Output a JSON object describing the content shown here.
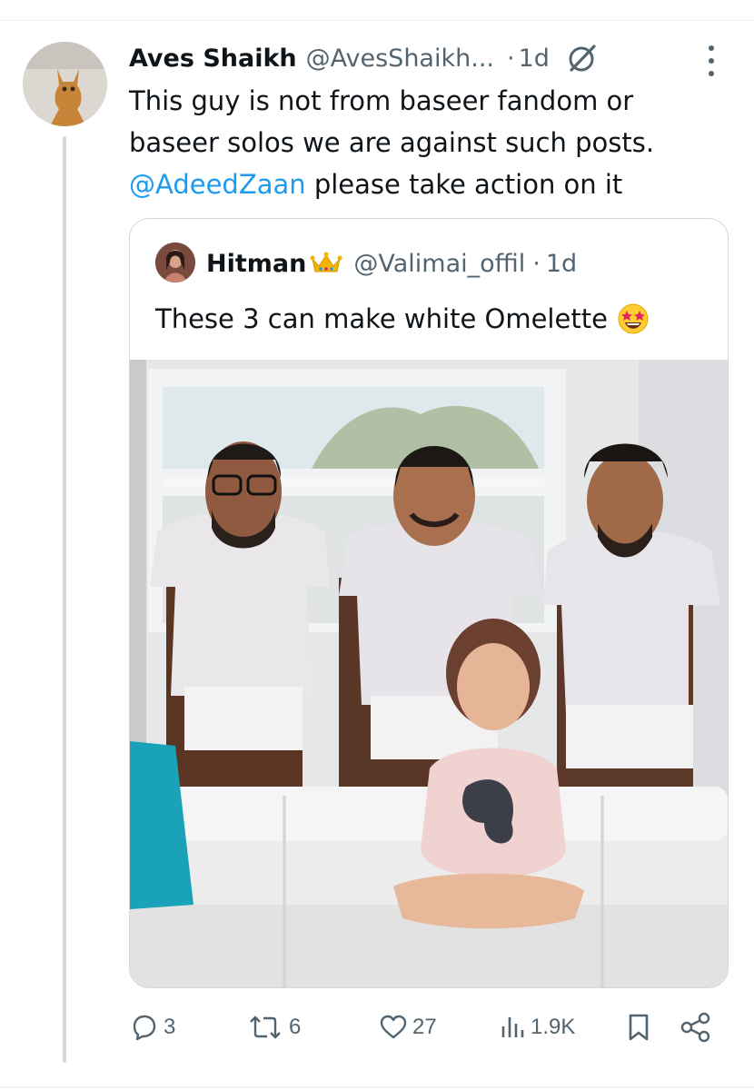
{
  "reply": {
    "author_name": "Aves Shaikh",
    "author_handle": "@AvesShaikh...",
    "separator": "·",
    "time": "1d",
    "text_line1": "This guy is not from baseer fandom or",
    "text_line2": "baseer solos we are against such posts.",
    "mention": "@AdeedZaan",
    "text_line3_rest": " please take action on it"
  },
  "quote": {
    "author_name": "Hitman",
    "author_handle": "@Valimai_offil",
    "separator": "·",
    "time": "1d",
    "text": "These 3 can make white Omelette"
  },
  "actions": {
    "replies": "3",
    "reposts": "6",
    "likes": "27",
    "views": "1.9K"
  },
  "icons": {
    "reply": "reply-icon",
    "repost": "repost-icon",
    "like": "heart-icon",
    "views": "views-icon",
    "bookmark": "bookmark-icon",
    "share": "share-icon",
    "grok": "grok-icon",
    "more": "more-icon"
  },
  "colors": {
    "link": "#1d9bf0",
    "secondary_text": "#536471",
    "primary_text": "#0f1419",
    "border": "#cfd9de"
  }
}
